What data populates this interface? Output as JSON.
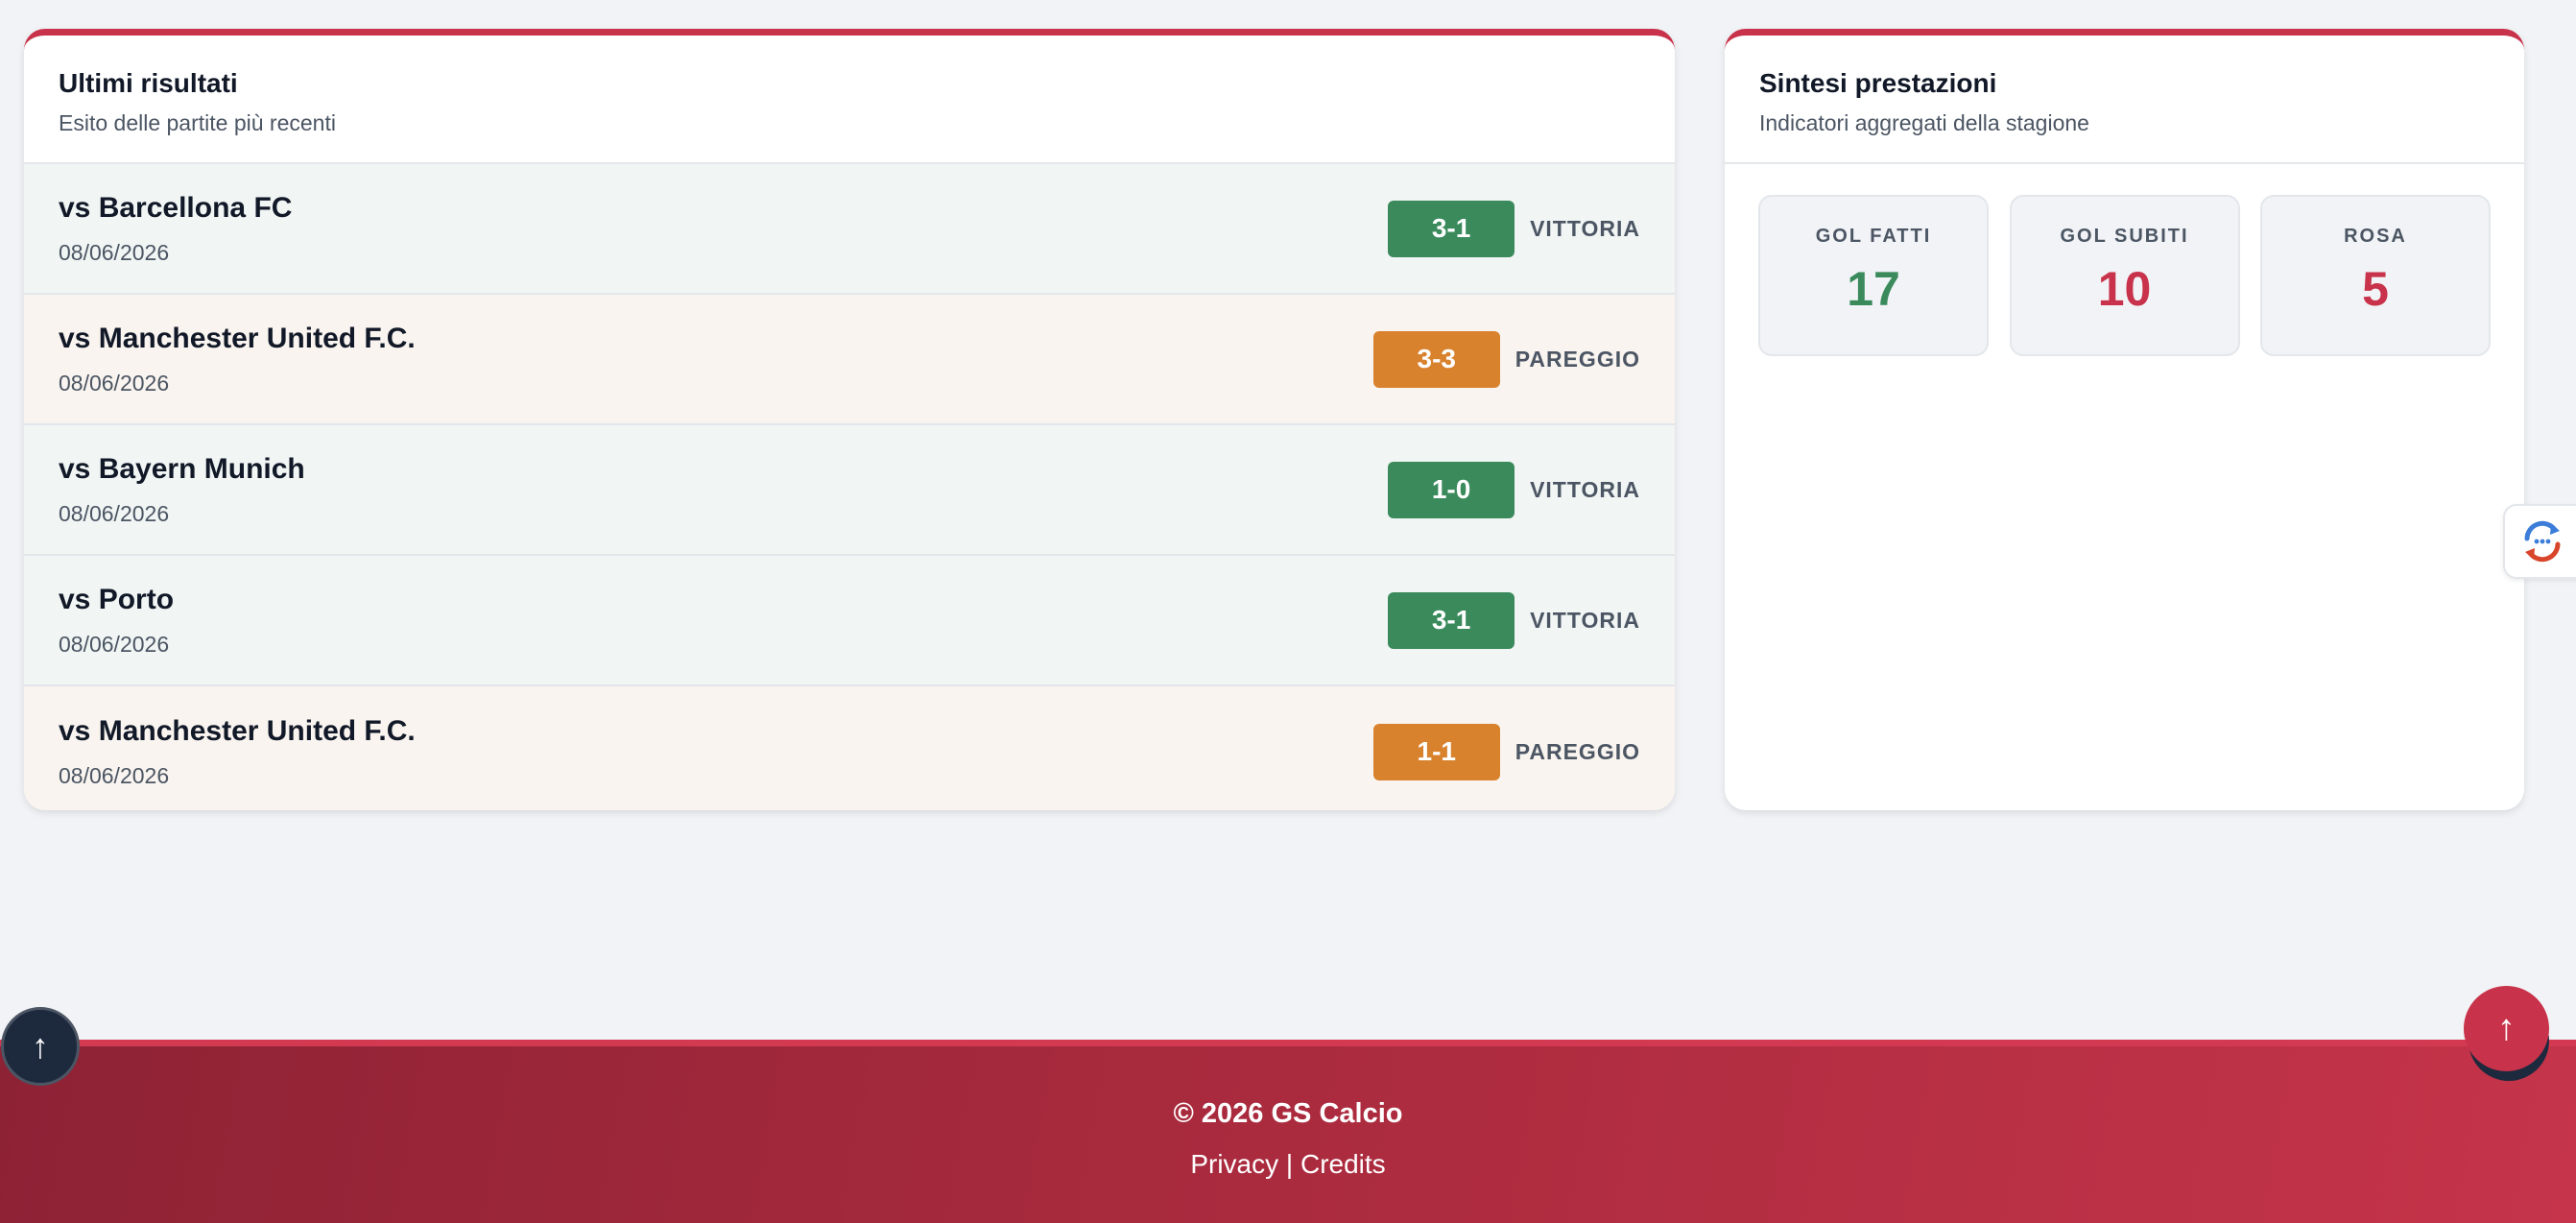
{
  "results": {
    "title": "Ultimi risultati",
    "subtitle": "Esito delle partite più recenti",
    "matches": [
      {
        "opponent": "vs Barcellona FC",
        "date": "08/06/2026",
        "score": "3-1",
        "outcome": "VITTORIA"
      },
      {
        "opponent": "vs Manchester United F.C.",
        "date": "08/06/2026",
        "score": "3-3",
        "outcome": "PAREGGIO"
      },
      {
        "opponent": "vs Bayern Munich",
        "date": "08/06/2026",
        "score": "1-0",
        "outcome": "VITTORIA"
      },
      {
        "opponent": "vs Porto",
        "date": "08/06/2026",
        "score": "3-1",
        "outcome": "VITTORIA"
      },
      {
        "opponent": "vs Manchester United F.C.",
        "date": "08/06/2026",
        "score": "1-1",
        "outcome": "PAREGGIO"
      }
    ]
  },
  "summary": {
    "title": "Sintesi prestazioni",
    "subtitle": "Indicatori aggregati della stagione",
    "stats": [
      {
        "label": "GOL FATTI",
        "value": "17",
        "color": "#3a8a5c"
      },
      {
        "label": "GOL SUBITI",
        "value": "10",
        "color": "#c8324a"
      },
      {
        "label": "ROSA",
        "value": "5",
        "color": "#c8324a"
      }
    ]
  },
  "colors": {
    "accent": "#c8324a",
    "win": "#3a8a5c",
    "draw": "#d8822e"
  },
  "icons": {
    "scroll_top": "↑",
    "side_widget": "refresh-chat-icon"
  },
  "footer": {
    "copyright": "© 2026 GS Calcio",
    "privacy": "Privacy",
    "separator": "|",
    "credits": "Credits"
  }
}
